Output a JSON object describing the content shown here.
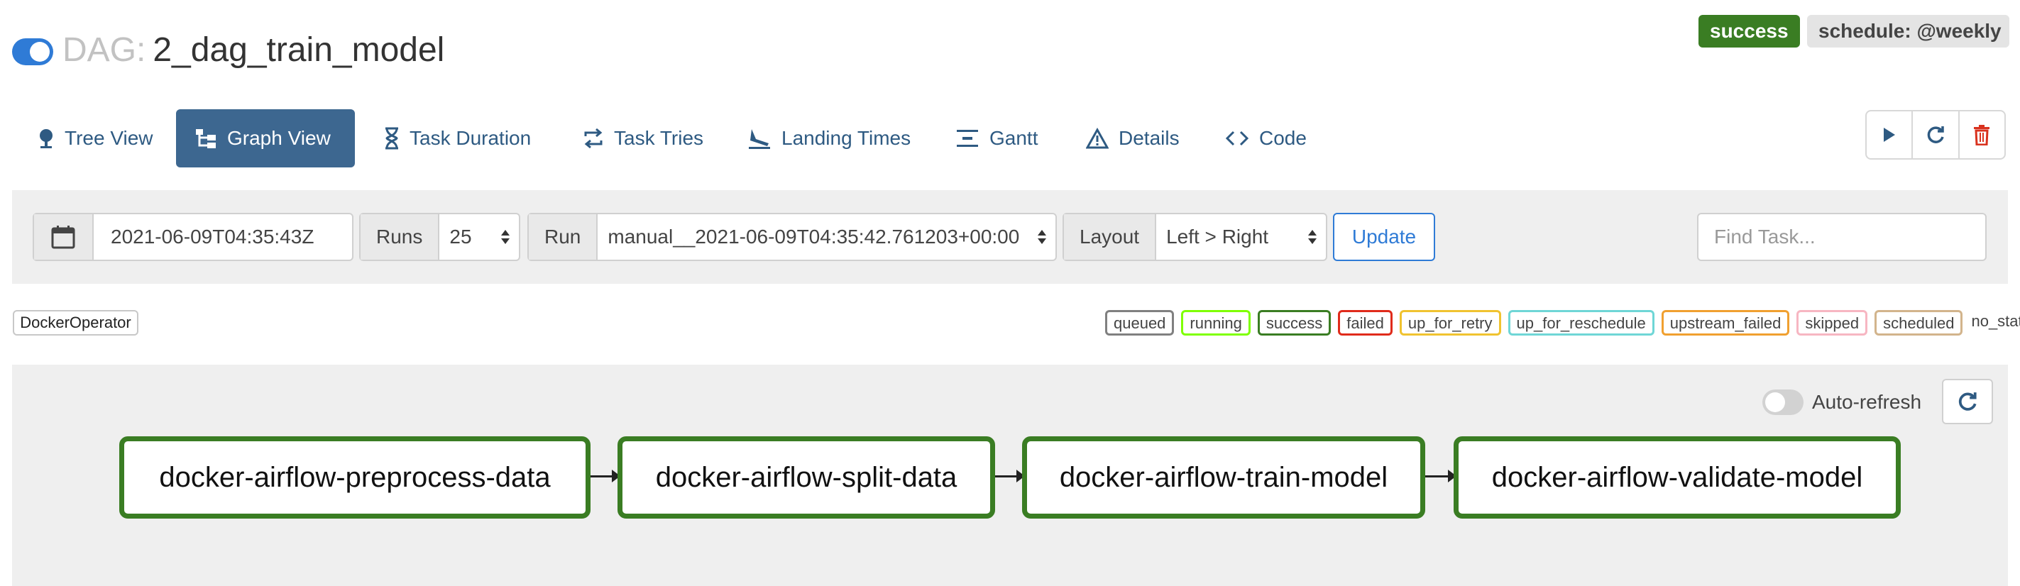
{
  "header": {
    "dag_prefix": "DAG:",
    "dag_name": "2_dag_train_model",
    "status_badge": "success",
    "schedule_badge": "schedule: @weekly"
  },
  "tabs": [
    {
      "label": "Tree View",
      "icon": "tree-icon",
      "active": false
    },
    {
      "label": "Graph View",
      "icon": "graph-icon",
      "active": true
    },
    {
      "label": "Task Duration",
      "icon": "hourglass-icon",
      "active": false
    },
    {
      "label": "Task Tries",
      "icon": "retry-icon",
      "active": false
    },
    {
      "label": "Landing Times",
      "icon": "plane-landing-icon",
      "active": false
    },
    {
      "label": "Gantt",
      "icon": "gantt-icon",
      "active": false
    },
    {
      "label": "Details",
      "icon": "warning-triangle-icon",
      "active": false
    },
    {
      "label": "Code",
      "icon": "code-icon",
      "active": false
    }
  ],
  "actions": {
    "trigger": "play-icon",
    "refresh": "refresh-icon",
    "delete": "trash-icon"
  },
  "filter": {
    "date_value": "2021-06-09T04:35:43Z",
    "runs_label": "Runs",
    "runs_value": "25",
    "run_label": "Run",
    "run_value": "manual__2021-06-09T04:35:42.761203+00:00",
    "layout_label": "Layout",
    "layout_value": "Left > Right",
    "update_label": "Update",
    "find_placeholder": "Find Task..."
  },
  "legend": {
    "operator": "DockerOperator",
    "states": [
      {
        "label": "queued",
        "color": "#808080"
      },
      {
        "label": "running",
        "color": "#7fff00"
      },
      {
        "label": "success",
        "color": "#3a7d23"
      },
      {
        "label": "failed",
        "color": "#e02b1b"
      },
      {
        "label": "up_for_retry",
        "color": "#f0c330"
      },
      {
        "label": "up_for_reschedule",
        "color": "#6fd6d6"
      },
      {
        "label": "upstream_failed",
        "color": "#f0a030"
      },
      {
        "label": "skipped",
        "color": "#f7b6c2"
      },
      {
        "label": "scheduled",
        "color": "#d2b48c"
      },
      {
        "label": "no_status",
        "color": ""
      }
    ]
  },
  "graph": {
    "auto_refresh_label": "Auto-refresh",
    "auto_refresh_on": false,
    "nodes": [
      "docker-airflow-preprocess-data",
      "docker-airflow-split-data",
      "docker-airflow-train-model",
      "docker-airflow-validate-model"
    ],
    "node_state_color": "#3a7d23"
  }
}
